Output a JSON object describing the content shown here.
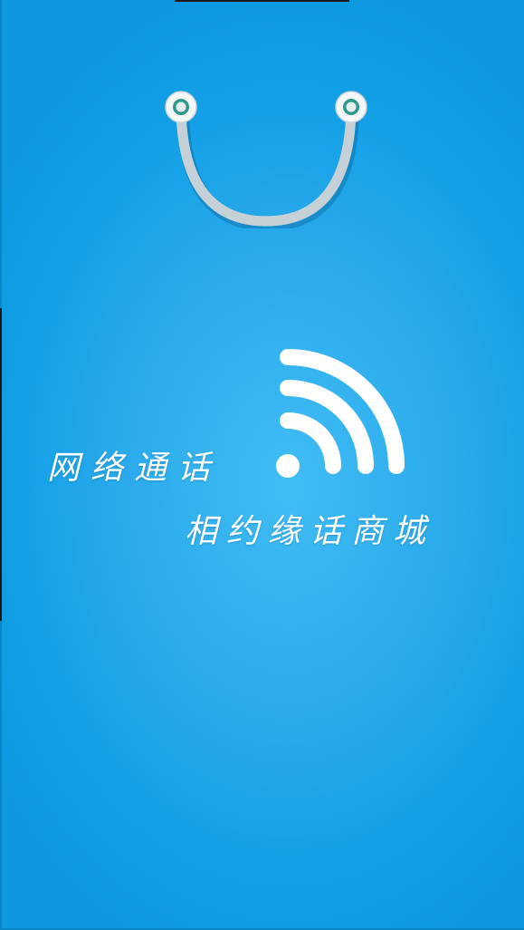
{
  "splash": {
    "slogan_line1": "网络通话",
    "slogan_line2": "相约缘话商城",
    "icons": {
      "bag_handle": "shopping-bag-handle-icon",
      "wifi": "wifi-signal-icon"
    }
  },
  "colors": {
    "background_center": "#41bdf5",
    "background_edge": "#0d98e0",
    "foreground": "#ffffff",
    "handle_ring": "#2f9a8a"
  }
}
